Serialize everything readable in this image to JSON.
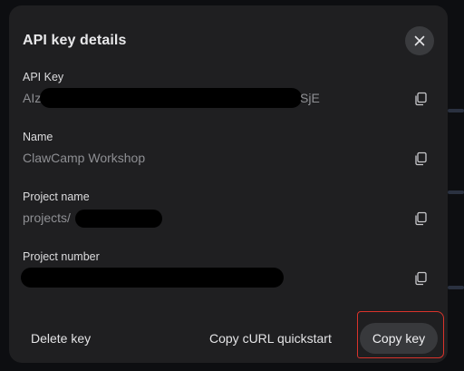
{
  "dialog": {
    "title": "API key details",
    "close_icon": "close-icon"
  },
  "fields": [
    {
      "label": "API Key",
      "value_prefix": "AIz",
      "value_suffix": "SjE",
      "copy_icon": "copy-icon"
    },
    {
      "label": "Name",
      "value": "ClawCamp Workshop",
      "copy_icon": "copy-icon"
    },
    {
      "label": "Project name",
      "value_prefix": "projects/",
      "copy_icon": "copy-icon"
    },
    {
      "label": "Project number",
      "copy_icon": "copy-icon"
    }
  ],
  "footer": {
    "delete_label": "Delete key",
    "curl_label": "Copy cURL quickstart",
    "copy_key_label": "Copy key"
  },
  "colors": {
    "dialog_bg": "#1f1f21",
    "primary_button_bg": "#38393c",
    "highlight": "#d9332b"
  }
}
